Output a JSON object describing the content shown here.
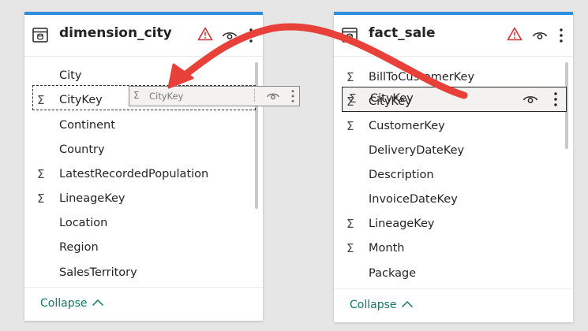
{
  "left_table": {
    "title": "dimension_city",
    "fields": [
      {
        "name": "City",
        "sigma": ""
      },
      {
        "name": "CityKey",
        "sigma": "Σ"
      },
      {
        "name": "Continent",
        "sigma": ""
      },
      {
        "name": "Country",
        "sigma": ""
      },
      {
        "name": "LatestRecordedPopulation",
        "sigma": "Σ"
      },
      {
        "name": "LineageKey",
        "sigma": "Σ"
      },
      {
        "name": "Location",
        "sigma": ""
      },
      {
        "name": "Region",
        "sigma": ""
      },
      {
        "name": "SalesTerritory",
        "sigma": ""
      }
    ],
    "collapse_label": "Collapse",
    "collapse_chevron": "^"
  },
  "right_table": {
    "title": "fact_sale",
    "fields": [
      {
        "name": "BillToCustomerKey",
        "sigma": "Σ"
      },
      {
        "name": "CityKey",
        "sigma": "Σ"
      },
      {
        "name": "CustomerKey",
        "sigma": "Σ"
      },
      {
        "name": "DeliveryDateKey",
        "sigma": ""
      },
      {
        "name": "Description",
        "sigma": ""
      },
      {
        "name": "InvoiceDateKey",
        "sigma": ""
      },
      {
        "name": "LineageKey",
        "sigma": "Σ"
      },
      {
        "name": "Month",
        "sigma": "Σ"
      },
      {
        "name": "Package",
        "sigma": ""
      }
    ],
    "collapse_label": "Collapse",
    "collapse_chevron": "^"
  },
  "drag_ghost": {
    "sigma": "Σ",
    "label": "CityKey"
  },
  "colors": {
    "accent": "#2f8fdf",
    "warning": "#d13438",
    "arrow": "#e8413a",
    "collapse_link": "#117865"
  }
}
